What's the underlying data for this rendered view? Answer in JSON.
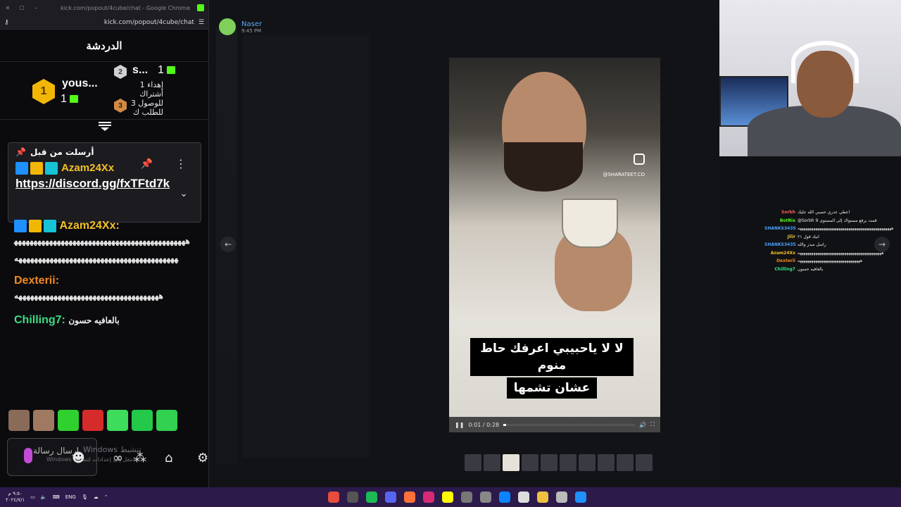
{
  "browser": {
    "title": "kick.com/popout/4cube/chat - Google Chrome",
    "url": "kick.com/popout/4cube/chat"
  },
  "chat": {
    "header": "الدردشة",
    "leaderboard": {
      "first_name": "yous...",
      "first_rank": "1",
      "first_count": "1",
      "second_name": "s...",
      "second_rank": "2",
      "second_count": "1",
      "third_rank": "3",
      "third_text": "إهداء 1 أشتراك للوصول 3 للطلب ك"
    },
    "pinned": {
      "header": "أرسلت من قبل",
      "username": "Azam24Xx",
      "link": "https://discord.gg/fxTFtd7k"
    },
    "messages": [
      {
        "username": "Azam24Xx:",
        "color": "#f5c125",
        "text": "ههههههههههههههههههههههههههههههههههههههههههههههههههههههههههههههههههههههههههههههههههههههه"
      },
      {
        "username": "Dexterii:",
        "color": "#f08a24",
        "text": "هههههههههههههههههههههههههههههههههههههه"
      },
      {
        "username": "Chilling7:",
        "color": "#3ddc84",
        "text": "بالعافيه حسون"
      }
    ],
    "composer_placeholder": "ارسال رسالة",
    "watermark_1": "Windows تنشيط",
    "watermark_2": "Windows انتقل إلى إعدادات لتنشيط"
  },
  "post": {
    "author": "Naser",
    "time": "9:45 PM",
    "instagram_handle": "@SHARATEET.CO",
    "subtitle_line1": "لا لا ياحبيبي اعرفك حاط منوم",
    "subtitle_line2": "عشان تشمها",
    "video_time": "0:01 / 0:28",
    "video_progress": 0.02
  },
  "overlay_chat": [
    {
      "name": "Sorbh",
      "color": "#ff5c5c",
      "text": "اعطي عذري حسبي الله عليك"
    },
    {
      "name": "BotRix",
      "color": "#53fc18",
      "text": "@Sorbh قمت برفع مستواك إلى المستوى 9"
    },
    {
      "name": "SHANKS3435",
      "color": "#4aa3ff",
      "text": "ههههههههههههههههههههههههههههههههههههههههههههههههه"
    },
    {
      "name": "Jilir",
      "color": "#e0c341",
      "text": "انيك قول ٢١"
    },
    {
      "name": "SHANKS3435",
      "color": "#4aa3ff",
      "text": "راسل ميدز والله"
    },
    {
      "name": "Azam24Xx",
      "color": "#f5c125",
      "text": "هههههههههههههههههههههههههههههههههههههههههههه"
    },
    {
      "name": "Dexterii",
      "color": "#f08a24",
      "text": "ههههههههههههههههههههههههههههههههه"
    },
    {
      "name": "Chilling7",
      "color": "#3ddc84",
      "text": "بالعافيه حسون"
    }
  ],
  "taskbar": {
    "time": "٩:٥٠ م",
    "date": "٢٠٢٤/٧/١",
    "lang": "ENG"
  },
  "icons": {
    "pin": "pin-icon",
    "kebab": "more-options-icon",
    "chevron": "chevron-down-icon"
  }
}
